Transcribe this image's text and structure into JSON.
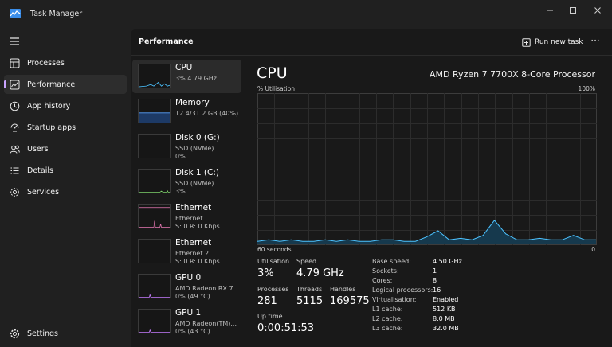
{
  "window": {
    "title": "Task Manager",
    "minimize_icon": "minimize-icon",
    "maximize_icon": "maximize-icon",
    "close_icon": "close-icon"
  },
  "sidebar": {
    "items": [
      {
        "label": "Processes",
        "icon": "processes-icon"
      },
      {
        "label": "Performance",
        "icon": "performance-icon",
        "active": true
      },
      {
        "label": "App history",
        "icon": "app-history-icon"
      },
      {
        "label": "Startup apps",
        "icon": "startup-apps-icon"
      },
      {
        "label": "Users",
        "icon": "users-icon"
      },
      {
        "label": "Details",
        "icon": "details-icon"
      },
      {
        "label": "Services",
        "icon": "services-icon"
      }
    ],
    "settings_label": "Settings"
  },
  "header": {
    "title": "Performance",
    "run_new_task": "Run new task",
    "more": "···"
  },
  "devices": [
    {
      "name": "CPU",
      "line1": "3% 4.79 GHz",
      "line2": ""
    },
    {
      "name": "Memory",
      "line1": "12.4/31.2 GB (40%)",
      "line2": ""
    },
    {
      "name": "Disk 0 (G:)",
      "line1": "SSD (NVMe)",
      "line2": "0%"
    },
    {
      "name": "Disk 1 (C:)",
      "line1": "SSD (NVMe)",
      "line2": "3%"
    },
    {
      "name": "Ethernet",
      "line1": "Ethernet",
      "line2": "S: 0 R: 0 Kbps"
    },
    {
      "name": "Ethernet",
      "line1": "Ethernet 2",
      "line2": "S: 0 R: 0 Kbps"
    },
    {
      "name": "GPU 0",
      "line1": "AMD Radeon RX 7...",
      "line2": "0% (49 °C)"
    },
    {
      "name": "GPU 1",
      "line1": "AMD Radeon(TM)...",
      "line2": "0% (43 °C)"
    }
  ],
  "detail": {
    "title": "CPU",
    "model": "AMD Ryzen 7 7700X 8-Core Processor",
    "util_label": "% Utilisation",
    "max_label": "100%",
    "time_label": "60 seconds",
    "min_label": "0",
    "stats": {
      "utilisation_label": "Utilisation",
      "utilisation": "3%",
      "speed_label": "Speed",
      "speed": "4.79 GHz",
      "processes_label": "Processes",
      "processes": "281",
      "threads_label": "Threads",
      "threads": "5115",
      "handles_label": "Handles",
      "handles": "169575",
      "uptime_label": "Up time",
      "uptime": "0:00:51:53"
    },
    "specs": [
      {
        "k": "Base speed:",
        "v": "4.50 GHz"
      },
      {
        "k": "Sockets:",
        "v": "1"
      },
      {
        "k": "Cores:",
        "v": "8"
      },
      {
        "k": "Logical processors:",
        "v": "16"
      },
      {
        "k": "Virtualisation:",
        "v": "Enabled"
      },
      {
        "k": "L1 cache:",
        "v": "512 KB"
      },
      {
        "k": "L2 cache:",
        "v": "8.0 MB"
      },
      {
        "k": "L3 cache:",
        "v": "32.0 MB"
      }
    ]
  },
  "colors": {
    "cpu_line": "#4cc2ff",
    "memory_line": "#5aa3ff",
    "ethernet_line": "#e879b5",
    "gpu_line": "#c67cff",
    "disk_line": "#7fd36c",
    "active_accent": "#c9a3ff"
  },
  "chart_data": {
    "type": "area",
    "ylim": [
      0,
      100
    ],
    "x": [
      0,
      2,
      4,
      6,
      8,
      10,
      12,
      14,
      16,
      18,
      20,
      22,
      24,
      26,
      28,
      30,
      32,
      34,
      36,
      38,
      40,
      42,
      44,
      46,
      48,
      50,
      52,
      54,
      56,
      58,
      60
    ],
    "values": [
      2,
      3,
      2,
      3,
      2,
      2,
      3,
      2,
      3,
      2,
      2,
      3,
      3,
      2,
      2,
      5,
      9,
      3,
      4,
      3,
      6,
      16,
      7,
      3,
      3,
      4,
      3,
      3,
      6,
      3,
      3
    ]
  }
}
